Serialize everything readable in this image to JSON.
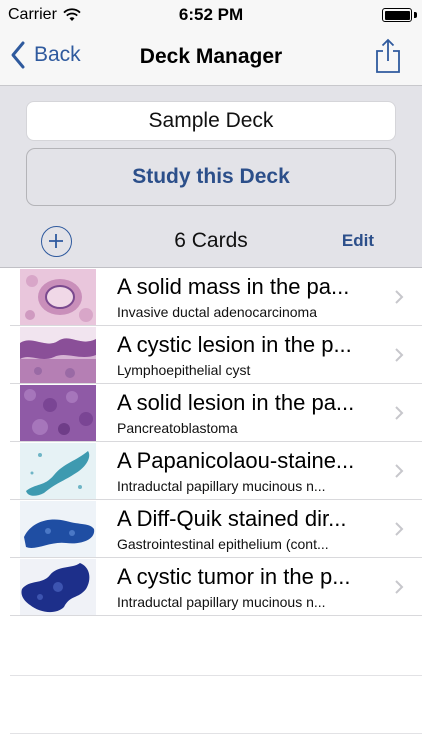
{
  "status_bar": {
    "carrier": "Carrier",
    "time": "6:52 PM",
    "wifi_icon": "wifi-icon",
    "battery_level": 1.0
  },
  "nav": {
    "back_label": "Back",
    "title": "Deck Manager",
    "share_icon": "share-icon"
  },
  "deck": {
    "name": "Sample Deck",
    "study_label": "Study this Deck",
    "card_count": "6 Cards",
    "edit_label": "Edit",
    "add_icon": "plus-circle-icon"
  },
  "cards": [
    {
      "title": "A solid mass in the pa...",
      "subtitle": "Invasive ductal adenocarcinoma",
      "thumb": "histology-pink"
    },
    {
      "title": "A cystic lesion in the p...",
      "subtitle": "Lymphoepithelial cyst",
      "thumb": "histology-purple-epithelium"
    },
    {
      "title": "A solid lesion in the pa...",
      "subtitle": "Pancreatoblastoma",
      "thumb": "histology-purple-dense"
    },
    {
      "title": "A Papanicolaou-staine...",
      "subtitle": "Intraductal papillary mucinous n...",
      "thumb": "cytology-pap"
    },
    {
      "title": "A Diff-Quik stained dir...",
      "subtitle": "Gastrointestinal epithelium (cont...",
      "thumb": "cytology-diffquik"
    },
    {
      "title": "A cystic tumor in the p...",
      "subtitle": "Intraductal papillary mucinous n...",
      "thumb": "cytology-blue"
    }
  ],
  "colors": {
    "accent": "#2f5a9e",
    "study_text": "#2c4f8a",
    "panel_bg": "#e3e3e8"
  }
}
